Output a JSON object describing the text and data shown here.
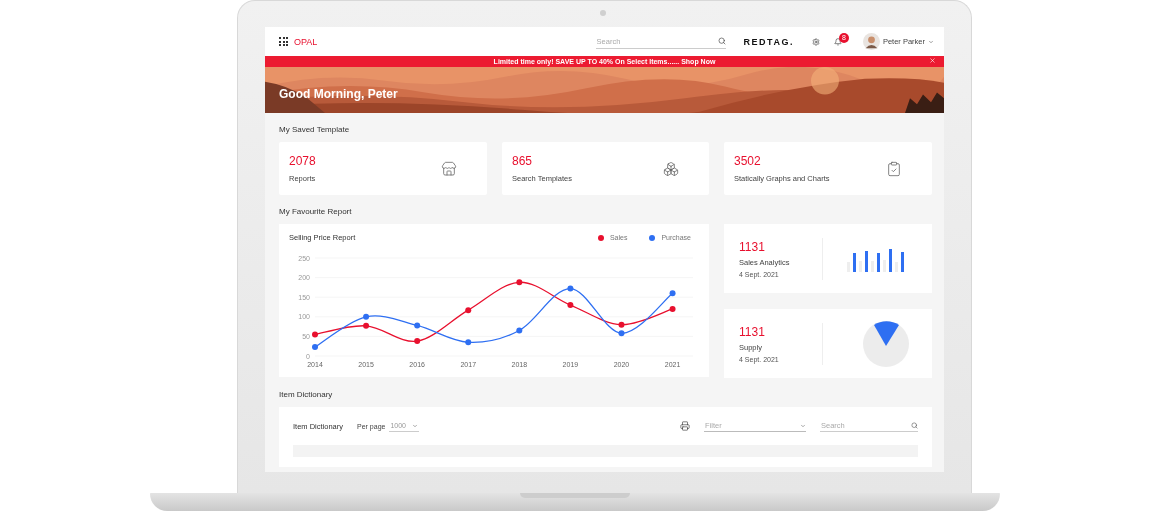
{
  "header": {
    "brand": "OPAL",
    "search": {
      "placeholder": "Search"
    },
    "logo": "REDTAG.",
    "notifications": {
      "badge": "8"
    },
    "user": {
      "name": "Peter Parker"
    }
  },
  "promo": {
    "text": "Limited time only! SAVE UP TO 40% On Select Items......",
    "link": "Shop Now"
  },
  "hero": {
    "greeting": "Good Morning, Peter",
    "kind": "picture"
  },
  "saved_templates": {
    "title": "My Saved Template",
    "cards": [
      {
        "value": "2078",
        "label": "Reports"
      },
      {
        "value": "865",
        "label": "Search Templates"
      },
      {
        "value": "3502",
        "label": "Statically Graphs and Charts"
      }
    ]
  },
  "favourite_report": {
    "title": "My Favourite Report",
    "chart": {
      "chart_data": {
        "type": "line",
        "title": "Selling Price Report",
        "grid": true,
        "x": [
          2014,
          2015,
          2016,
          2017,
          2018,
          2019,
          2020,
          2021
        ],
        "xticks": [
          2014,
          2015,
          2016,
          2017,
          2018,
          2019,
          2020,
          2021
        ],
        "xlim": [
          2014,
          2021.4
        ],
        "ylim": [
          0,
          250
        ],
        "yticks": [
          0,
          50,
          100,
          150,
          200,
          250
        ],
        "series": [
          {
            "name": "Sales",
            "color": "#e8102e",
            "marker": true,
            "values": [
              55,
              77,
              38,
              117,
              188,
              130,
              80,
              120
            ]
          },
          {
            "name": "Purchase",
            "color": "#2e6ff2",
            "marker": true,
            "values": [
              23,
              100,
              78,
              35,
              65,
              172,
              58,
              160
            ]
          }
        ]
      }
    },
    "stats": [
      {
        "value": "1131",
        "label": "Sales Analytics",
        "date": "4 Sept. 2021",
        "kind": "bars"
      },
      {
        "value": "1131",
        "label": "Supply",
        "date": "4 Sept. 2021",
        "kind": "pie"
      }
    ]
  },
  "item_dictionary": {
    "title": "Item Dictionary",
    "card_title": "Item Dictionary",
    "per_page_label": "Per page",
    "per_page": "1000",
    "filter": {
      "placeholder": "Filter"
    },
    "search": {
      "placeholder": "Search"
    }
  }
}
